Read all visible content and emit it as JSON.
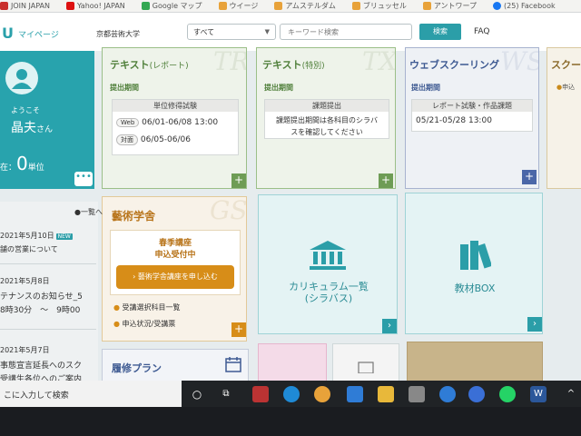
{
  "bookmarks": [
    {
      "label": "JOIN JAPAN",
      "color": "#c9302c"
    },
    {
      "label": "Yahoo! JAPAN",
      "color": "#d11"
    },
    {
      "label": "Google マップ",
      "color": "#34a853"
    },
    {
      "label": "ウイージ",
      "color": "#e8a23a"
    },
    {
      "label": "アムステルダム",
      "color": "#e8a23a"
    },
    {
      "label": "ブリュッセル",
      "color": "#e8a23a"
    },
    {
      "label": "アントワープ",
      "color": "#e8a23a"
    },
    {
      "label": "(25) Facebook",
      "color": "#1877f2"
    }
  ],
  "header": {
    "logo": "U",
    "mypage": "マイページ",
    "university": "京都芸術大学",
    "select_value": "すべて",
    "keyword_placeholder": "キーワード検索",
    "search_button": "検索",
    "faq": "FAQ"
  },
  "profile": {
    "greeting": "ようこそ",
    "name": "晶夫",
    "honorific": "さん",
    "credits_prefix": "在：",
    "credits_value": "0",
    "credits_unit": "単位",
    "more": "•••"
  },
  "cards": {
    "report": {
      "title": "テキスト",
      "title_sub": "(レポート)",
      "watermark": "TR",
      "period_label": "提出期間",
      "box_head": "単位修得試験",
      "rows": [
        {
          "tag": "Web",
          "dates": "06/01-06/08 13:00"
        },
        {
          "tag": "対面",
          "dates": "06/05-06/06"
        }
      ],
      "plus": "+"
    },
    "special": {
      "title": "テキスト",
      "title_sub": "(特別)",
      "watermark": "TX",
      "period_label": "提出期間",
      "box_head": "課題提出",
      "box_text_1": "課題提出期間は各科目のシラバ",
      "box_text_2": "スを確認してください",
      "plus": "+"
    },
    "web_schooling": {
      "title": "ウェブスクーリング",
      "watermark": "WS",
      "period_label": "提出期間",
      "box_head": "レポート試験・作品課題",
      "dates": "05/21-05/28 13:00",
      "plus": "+"
    },
    "schooling": {
      "title": "スクー",
      "sub": "申込"
    },
    "geijutsu": {
      "title": "藝術学舎",
      "watermark": "GS",
      "season": "春季講座",
      "status": "申込受付中",
      "apply_button": "藝術学舎講座を申し込む",
      "link_1": "受講選択科目一覧",
      "link_2": "申込状況/受講票",
      "plus": "+"
    },
    "curriculum": {
      "label_1": "カリキュラム一覧",
      "label_2": "(シラバス)",
      "chev": "›"
    },
    "textbook": {
      "label": "教材BOX",
      "chev": "›"
    },
    "rishu": {
      "title": "履修プラン"
    }
  },
  "news": {
    "all": "一覧へ",
    "items": [
      {
        "date": "2021年5月10日",
        "new": "NEW",
        "text": "舗の営業について"
      },
      {
        "date": "2021年5月8日",
        "text_1": "テナンスのお知らせ_5",
        "text_2": "8時30分　～　9時00"
      },
      {
        "date": "2021年5月7日",
        "text_1": "事態宣言延長へのスク",
        "text_2": "受講生各位へのご案内"
      }
    ]
  },
  "taskbar": {
    "search_text": "こに入力して検索"
  }
}
